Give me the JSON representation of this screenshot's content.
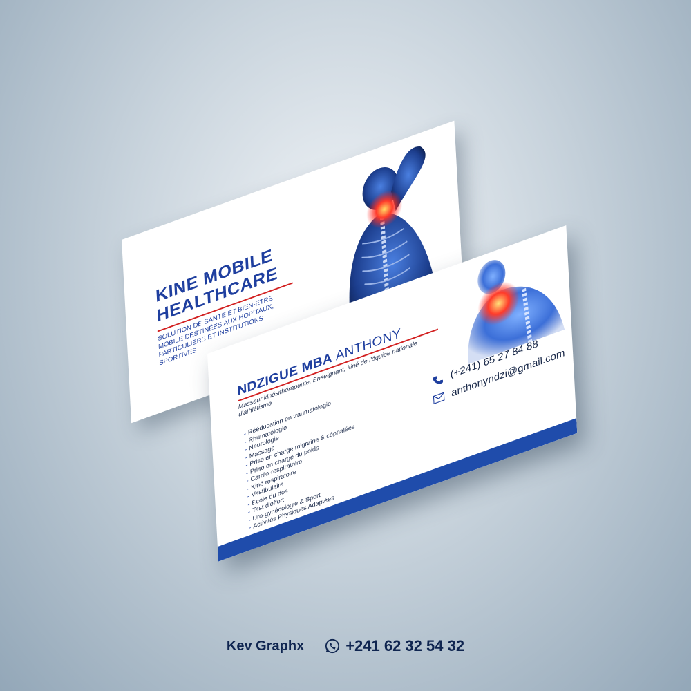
{
  "back_card": {
    "title_line1": "KINE MOBILE",
    "title_line2": "HEALTHCARE",
    "tagline": "SOLUTION DE SANTE ET BIEN-ETRE MOBILE DESTINÉES AUX HOPITAUX, PARTICULIERS ET INSTITUTIONS SPORTIVES"
  },
  "front_card": {
    "name_last": "NDZIGUE MBA",
    "name_first": "ANTHONY",
    "role": "Masseur kinésithérapeute, Enseignant, kiné de l'équipe nationale d'athlétisme",
    "services": [
      "Rééducation en traumatologie",
      "Rhumatologie",
      "Neurologie",
      "Massage",
      "Prise en charge migraine & céphalées",
      "Prise en charge du poids",
      "Cardio-respiratoire",
      "Kiné respiratoire",
      "Vestibulaire",
      "Ecole du dos",
      "Test d'effort",
      "Uro-gynécologie & Sport",
      "Activités Physiques Adaptées"
    ],
    "phone": "(+241) 65 27 84 88",
    "email": "anthonyndzi@gmail.com"
  },
  "footer": {
    "brand": "Kev Graphx",
    "phone": "+241 62 32 54 32"
  },
  "colors": {
    "brand_blue": "#1f3f9f",
    "band_blue": "#1f4cab",
    "accent_red": "#d22020"
  },
  "icons": {
    "phone": "phone-icon",
    "email": "envelope-icon",
    "whatsapp": "whatsapp-icon"
  }
}
